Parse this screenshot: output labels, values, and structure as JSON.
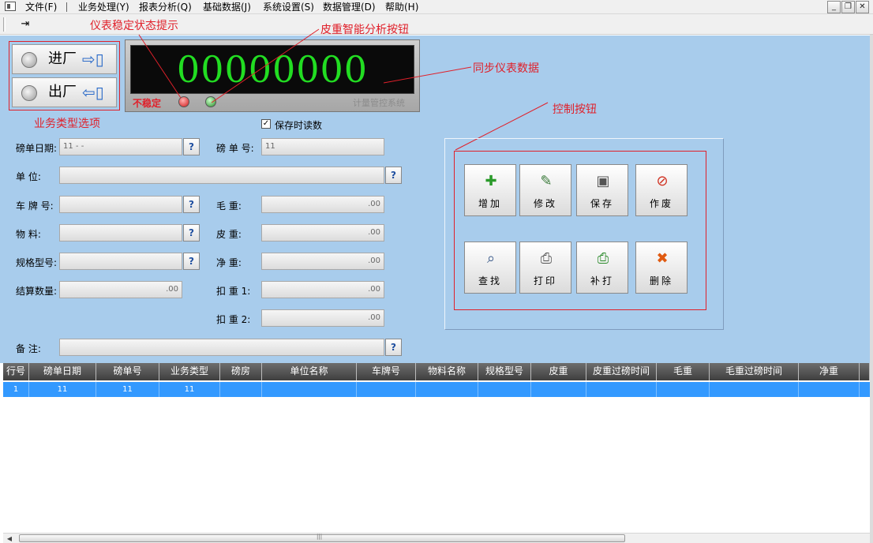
{
  "menu": {
    "items": [
      "文件(F)",
      "业务处理(Y)",
      "报表分析(Q)",
      "基础数据(J)",
      "系统设置(S)",
      "数据管理(D)",
      "帮助(H)"
    ],
    "window_controls": [
      "minimize",
      "restore",
      "close"
    ]
  },
  "toolbar": {
    "exit_icon": "exit-icon"
  },
  "annotations": {
    "meter_status_hint": "仪表稳定状态提示",
    "tare_analysis_button": "皮重智能分析按钮",
    "sync_meter_data": "同步仪表数据",
    "control_buttons": "控制按钮",
    "business_type_options": "业务类型选项"
  },
  "business_type": {
    "in_label": "进厂",
    "out_label": "出厂"
  },
  "meter": {
    "display": "00000000",
    "status": "不稳定",
    "system_name": "计量管控系统"
  },
  "save_reading": {
    "label": "保存时读数",
    "checked": true
  },
  "form": {
    "date_label": "磅单日期:",
    "date_value": "11  -  -",
    "ticket_no_label": "磅 单 号:",
    "ticket_no_value": "11",
    "unit_label": "单      位:",
    "unit_value": "",
    "plate_label": "车 牌 号:",
    "plate_value": "",
    "gross_label": "毛      重:",
    "gross_value": ".00",
    "material_label": "物      料:",
    "material_value": "",
    "tare_label": "皮      重:",
    "tare_value": ".00",
    "spec_label": "规格型号:",
    "spec_value": "",
    "net_label": "净      重:",
    "net_value": ".00",
    "settle_label": "结算数量:",
    "settle_value": ".00",
    "deduct1_label": "扣   重 1:",
    "deduct1_value": ".00",
    "deduct2_label": "扣   重 2:",
    "deduct2_value": ".00",
    "remark_label": "备      注:",
    "remark_value": "",
    "help_button": "?"
  },
  "controls": {
    "add": "增加",
    "edit": "修改",
    "save": "保存",
    "void": "作废",
    "find": "查找",
    "print": "打印",
    "reprint": "补打",
    "delete": "删除"
  },
  "grid": {
    "columns": [
      "行号",
      "磅单日期",
      "磅单号",
      "业务类型",
      "磅房",
      "单位名称",
      "车牌号",
      "物料名称",
      "规格型号",
      "皮重",
      "皮重过磅时间",
      "毛重",
      "毛重过磅时间",
      "净重"
    ],
    "rows": [
      [
        "1",
        "11",
        "11",
        "11",
        "",
        "",
        "",
        "",
        "",
        "",
        "",
        "",
        "",
        ""
      ]
    ]
  },
  "colors": {
    "annotation": "#e0202a",
    "panel_bg": "#a8ccec",
    "selected_row": "#3399ff",
    "digits": "#22dd22"
  }
}
